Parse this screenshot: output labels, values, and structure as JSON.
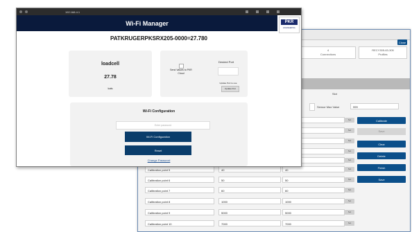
{
  "back_window": {
    "close_label": "Close",
    "stats": [
      {
        "value": "4",
        "label": "Connections"
      },
      {
        "value": "RECY305-63-305",
        "label": "Profiles"
      }
    ],
    "tab_label": "Slot",
    "sensor_max_label": "Sensor Max Value",
    "sensor_max_value": "999",
    "calibration_rows": [
      {
        "label": "",
        "v1": "",
        "v2": ""
      },
      {
        "label": "",
        "v1": "",
        "v2": ""
      },
      {
        "label": "",
        "v1": "",
        "v2": ""
      },
      {
        "label": "",
        "v1": "",
        "v2": ""
      },
      {
        "label": "",
        "v1": "",
        "v2": ""
      },
      {
        "label": "Calibration point 5",
        "v1": "40",
        "v2": "40"
      },
      {
        "label": "Calibration point 6",
        "v1": "50",
        "v2": "50"
      },
      {
        "label": "Calibration point 7",
        "v1": "60",
        "v2": "60"
      },
      {
        "label": "Calibration point 8",
        "v1": "1000",
        "v2": "1000"
      },
      {
        "label": "Calibration point 9",
        "v1": "5000",
        "v2": "5000"
      },
      {
        "label": "Calibration point 10",
        "v1": "7000",
        "v2": "7000"
      }
    ],
    "set_label": "Set",
    "side_buttons": [
      "Calibrate",
      "Save",
      "Clear",
      "Delete",
      "Finish",
      "Save"
    ]
  },
  "front_window": {
    "url": "192.168.4.1",
    "header_title": "Wi-Fi Manager",
    "brand": "PKR",
    "brand_sub": "ENGINEERING",
    "device_title": "PATKRUGERPKSRX205-0000=27.780",
    "sensor_card": {
      "name": "loadcell",
      "value": "27.78",
      "unit": "kals"
    },
    "upload_card": {
      "label": "Send Values to PKR Cloud",
      "desired_port_label": "Desired Port",
      "note": "Update Port to use",
      "update_port_label": "Update Port"
    },
    "wifi_card": {
      "title": "Wi-Fi Configuration",
      "password_placeholder": "Enter password",
      "configure_label": "Wi-Fi Configuration",
      "reset_label": "Reset",
      "change_password_link": "Change Password"
    }
  }
}
